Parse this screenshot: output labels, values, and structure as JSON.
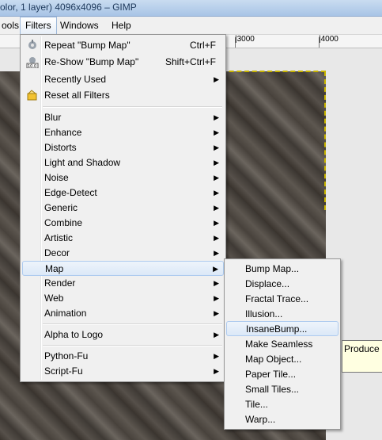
{
  "window": {
    "title": "olor, 1 layer) 4096x4096 – GIMP"
  },
  "menubar": {
    "items": [
      {
        "label": "ools"
      },
      {
        "label": "Filters",
        "active": true
      },
      {
        "label": "Windows"
      },
      {
        "label": "Help"
      }
    ]
  },
  "ruler": {
    "labels": [
      "|3000",
      "|4000"
    ]
  },
  "filters_menu": {
    "items": [
      {
        "label": "Repeat \"Bump Map\"",
        "shortcut": "Ctrl+F",
        "icon": "repeat-filter-icon"
      },
      {
        "label": "Re-Show \"Bump Map\"",
        "shortcut": "Shift+Ctrl+F",
        "icon": "reshow-filter-icon"
      },
      {
        "label": "Recently Used",
        "submenu": true
      },
      {
        "label": "Reset all Filters",
        "icon": "reset-filters-icon"
      },
      {
        "label": "Blur",
        "submenu": true
      },
      {
        "label": "Enhance",
        "submenu": true
      },
      {
        "label": "Distorts",
        "submenu": true
      },
      {
        "label": "Light and Shadow",
        "submenu": true
      },
      {
        "label": "Noise",
        "submenu": true
      },
      {
        "label": "Edge-Detect",
        "submenu": true
      },
      {
        "label": "Generic",
        "submenu": true
      },
      {
        "label": "Combine",
        "submenu": true
      },
      {
        "label": "Artistic",
        "submenu": true
      },
      {
        "label": "Decor",
        "submenu": true
      },
      {
        "label": "Map",
        "submenu": true,
        "highlighted": true
      },
      {
        "label": "Render",
        "submenu": true
      },
      {
        "label": "Web",
        "submenu": true
      },
      {
        "label": "Animation",
        "submenu": true
      },
      {
        "label": "Alpha to Logo",
        "submenu": true
      },
      {
        "label": "Python-Fu",
        "submenu": true
      },
      {
        "label": "Script-Fu",
        "submenu": true
      }
    ]
  },
  "map_menu": {
    "items": [
      {
        "label": "Bump Map..."
      },
      {
        "label": "Displace..."
      },
      {
        "label": "Fractal Trace..."
      },
      {
        "label": "Illusion..."
      },
      {
        "label": "InsaneBump...",
        "highlighted": true
      },
      {
        "label": "Make Seamless"
      },
      {
        "label": "Map Object..."
      },
      {
        "label": "Paper Tile..."
      },
      {
        "label": "Small Tiles..."
      },
      {
        "label": "Tile..."
      },
      {
        "label": "Warp..."
      }
    ]
  },
  "tooltip": {
    "text": "Produce"
  },
  "submenu_arrow": "▶",
  "colors": {
    "highlight": "#dbe8f7",
    "highlight_border": "#aecbef",
    "menu_bg": "#f0f0f0",
    "tooltip_bg": "#ffffe1"
  }
}
